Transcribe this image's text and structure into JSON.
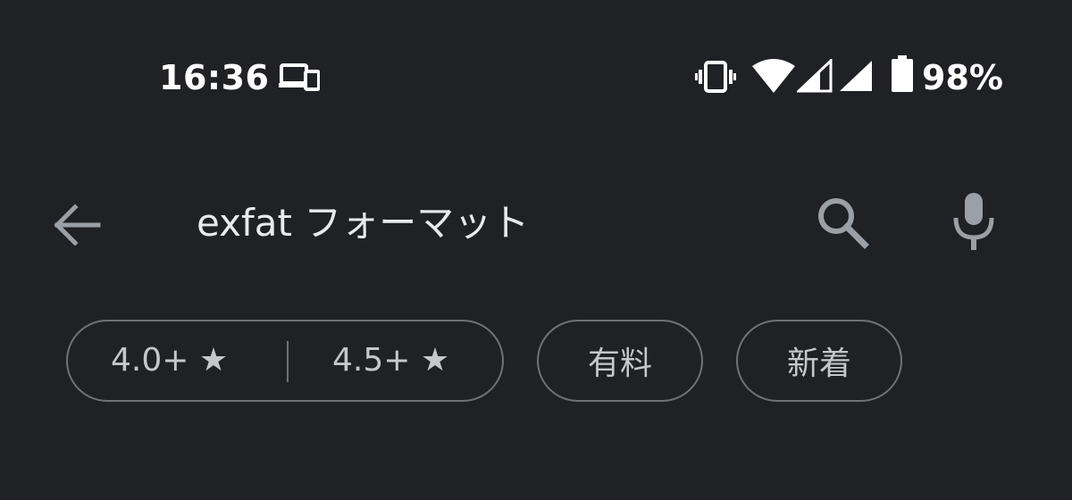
{
  "status_bar": {
    "time": "16:36",
    "battery_percent": "98%",
    "icons": [
      "cast-icon",
      "vibrate-icon",
      "wifi-icon",
      "signal-icon",
      "signal-icon",
      "battery-icon"
    ]
  },
  "search": {
    "query": "exfat フォーマット",
    "icons": {
      "back": "arrow-back-icon",
      "search": "search-icon",
      "mic": "mic-icon"
    }
  },
  "filters": {
    "rating_options": [
      "4.0+ ★",
      "4.5+ ★"
    ],
    "paid_label": "有料",
    "new_label": "新着"
  },
  "colors": {
    "background": "#202124",
    "text": "#e8eaed",
    "chip_text": "#c6c7ca",
    "chip_border": "#6f7276",
    "icon_gray": "#9aa0a6"
  }
}
